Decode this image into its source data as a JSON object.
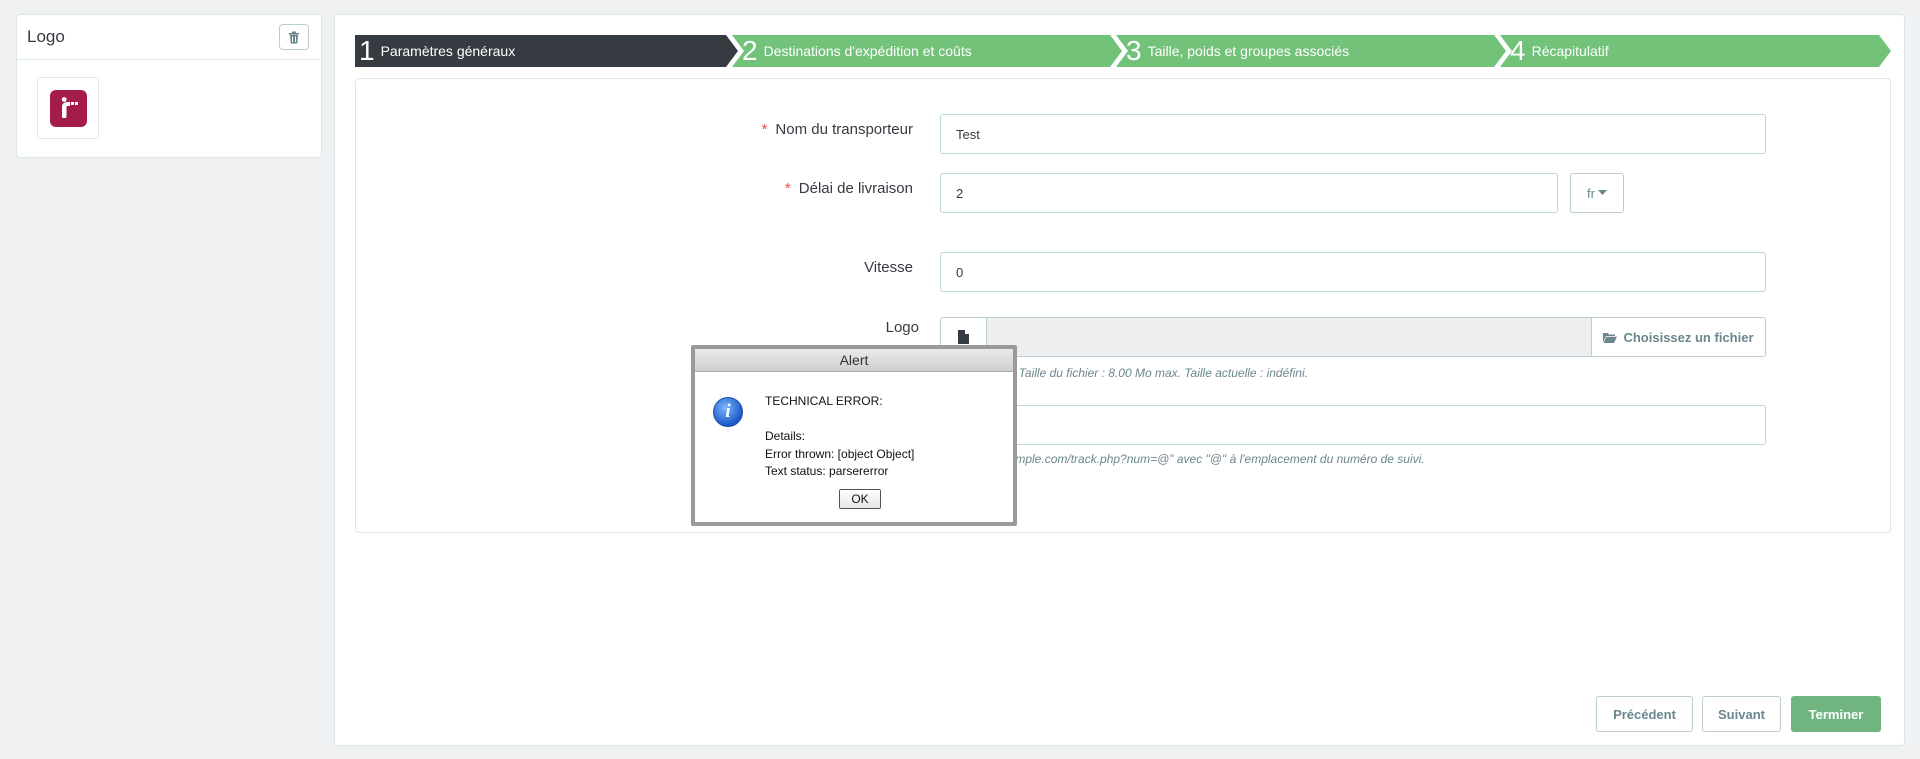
{
  "sidebar": {
    "title": "Logo",
    "delete_icon": "trash-icon",
    "logo_alt": "carrier-logo"
  },
  "wizard": {
    "steps": [
      {
        "number": "1",
        "label": "Paramètres généraux",
        "state": "active",
        "color": "#363a41"
      },
      {
        "number": "2",
        "label": "Destinations d'expédition et coûts",
        "state": "pending",
        "color": "#72c279"
      },
      {
        "number": "3",
        "label": "Taille, poids et groupes associés",
        "state": "pending",
        "color": "#72c279"
      },
      {
        "number": "4",
        "label": "Récapitulatif",
        "state": "pending",
        "color": "#72c279"
      }
    ]
  },
  "form": {
    "carrier_name": {
      "required_mark": "*",
      "label": "Nom du transporteur",
      "value": "Test"
    },
    "delay": {
      "required_mark": "*",
      "label": "Délai de livraison",
      "value": "2",
      "lang": "fr"
    },
    "speed": {
      "label": "Vitesse",
      "value": "0"
    },
    "logo": {
      "label": "Logo",
      "choose_label": "Choisissez un fichier",
      "help": "PNG. Taille du fichier : 8.00 Mo max. Taille actuelle : indéfini."
    },
    "tracking": {
      "value": "",
      "help": "://example.com/track.php?num=@\" avec \"@\" à l'emplacement du numéro de suivi."
    }
  },
  "footer": {
    "prev_label": "Précédent",
    "next_label": "Suivant",
    "finish_label": "Terminer"
  },
  "alert": {
    "title": "Alert",
    "message": "TECHNICAL ERROR:\n\nDetails:\nError thrown: [object Object]\nText status: parsererror",
    "ok_label": "OK",
    "icon": "info-icon"
  },
  "colors": {
    "accent_green": "#72c279",
    "active_step": "#363a41",
    "required": "#f54c3e"
  }
}
